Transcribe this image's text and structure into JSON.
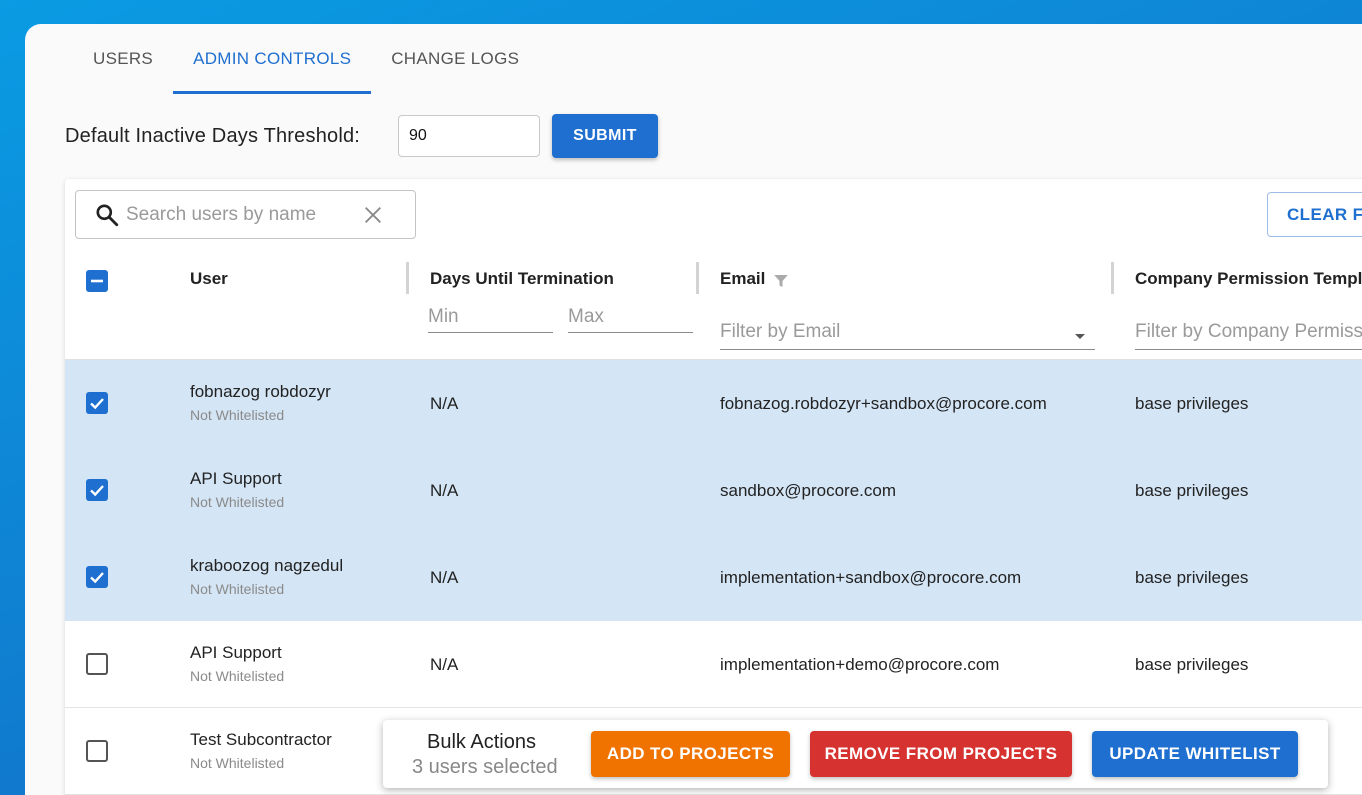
{
  "tabs": [
    {
      "label": "USERS",
      "active": false
    },
    {
      "label": "ADMIN CONTROLS",
      "active": true
    },
    {
      "label": "CHANGE LOGS",
      "active": false
    }
  ],
  "threshold": {
    "label": "Default Inactive Days Threshold:",
    "value": "90",
    "submit_label": "SUBMIT"
  },
  "search": {
    "placeholder": "Search users by name",
    "value": ""
  },
  "clear_filters_label": "CLEAR FILTERS",
  "columns": {
    "user": "User",
    "days": "Days Until Termination",
    "email": "Email",
    "permission": "Company Permission Template"
  },
  "filters": {
    "min_placeholder": "Min",
    "max_placeholder": "Max",
    "email_placeholder": "Filter by Email",
    "permission_placeholder": "Filter by Company Permission Template"
  },
  "rows": [
    {
      "name": "fobnazog robdozyr",
      "status": "Not Whitelisted",
      "days": "N/A",
      "email": "fobnazog.robdozyr+sandbox@procore.com",
      "permission": "base privileges",
      "selected": true
    },
    {
      "name": "API Support",
      "status": "Not Whitelisted",
      "days": "N/A",
      "email": "sandbox@procore.com",
      "permission": "base privileges",
      "selected": true
    },
    {
      "name": "kraboozog nagzedul",
      "status": "Not Whitelisted",
      "days": "N/A",
      "email": "implementation+sandbox@procore.com",
      "permission": "base privileges",
      "selected": true
    },
    {
      "name": "API Support",
      "status": "Not Whitelisted",
      "days": "N/A",
      "email": "implementation+demo@procore.com",
      "permission": "base privileges",
      "selected": false
    },
    {
      "name": "Test Subcontractor",
      "status": "Not Whitelisted",
      "days": "",
      "email": "",
      "permission": "",
      "selected": false
    }
  ],
  "bulk_actions": {
    "title": "Bulk Actions",
    "selected_text": "3 users selected",
    "add_label": "ADD TO PROJECTS",
    "remove_label": "REMOVE FROM PROJECTS",
    "whitelist_label": "UPDATE WHITELIST"
  },
  "colors": {
    "primary": "#1e6fcf",
    "selected_row": "#d4e5f5",
    "add_button": "#f07300",
    "remove_button": "#d63230"
  }
}
